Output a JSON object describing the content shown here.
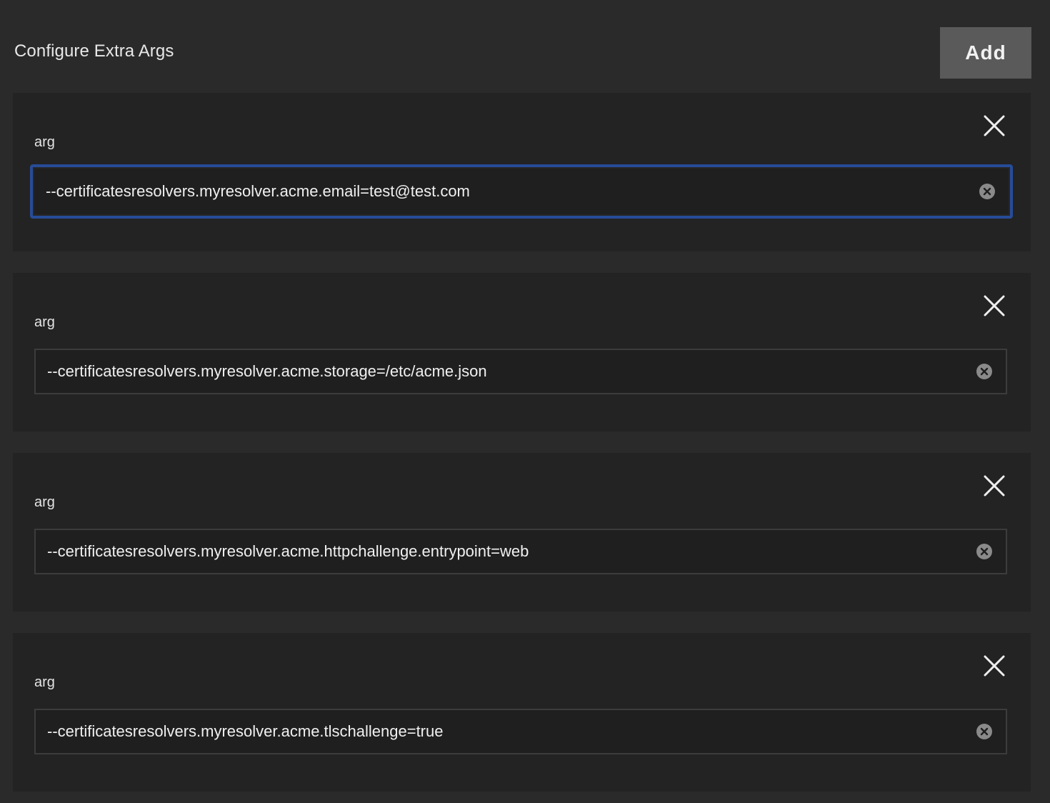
{
  "header": {
    "title": "Configure Extra Args",
    "add_label": "Add"
  },
  "args": [
    {
      "label": "arg",
      "value": "--certificatesresolvers.myresolver.acme.email=test@test.com",
      "focused": true
    },
    {
      "label": "arg",
      "value": "--certificatesresolvers.myresolver.acme.storage=/etc/acme.json",
      "focused": false
    },
    {
      "label": "arg",
      "value": "--certificatesresolvers.myresolver.acme.httpchallenge.entrypoint=web",
      "focused": false
    },
    {
      "label": "arg",
      "value": "--certificatesresolvers.myresolver.acme.tlschallenge=true",
      "focused": false
    }
  ],
  "icons": {
    "remove": "close-icon",
    "clear": "clear-circle-icon"
  },
  "colors": {
    "focus_ring": "#274c97",
    "background": "#2a2a2b",
    "card": "#232324",
    "button": "#5a5a5a"
  }
}
